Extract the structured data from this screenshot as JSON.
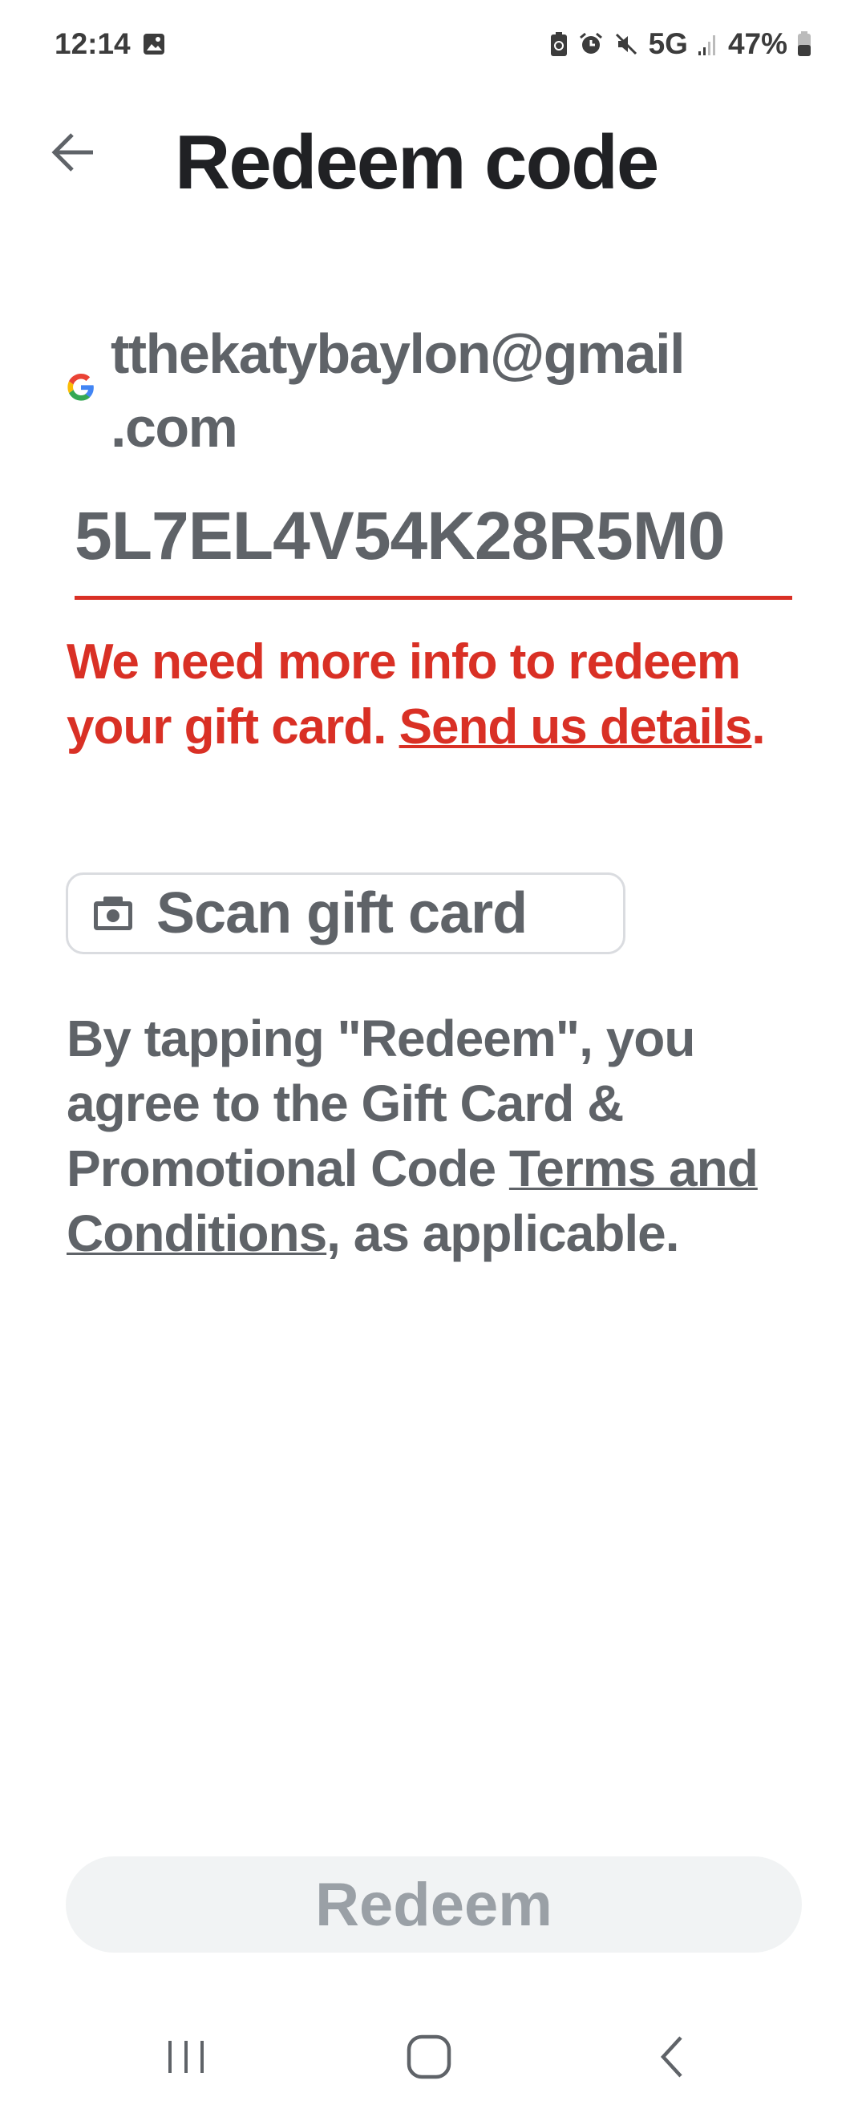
{
  "status_bar": {
    "time": "12:14",
    "network": "5G",
    "battery": "47%",
    "icons": [
      "image-icon",
      "battery-saver-icon",
      "alarm-icon",
      "mute-icon",
      "signal-icon",
      "battery-icon"
    ]
  },
  "header": {
    "title": "Redeem code",
    "back_icon": "arrow-left-icon"
  },
  "account": {
    "email": "tthekatybaylon@gmail.com",
    "email_line1": "tthekatybaylon@gmail",
    "email_line2": ".com"
  },
  "code_input": {
    "value": "5L7EL4V54K28R5M0",
    "underline_color": "#d93025"
  },
  "error": {
    "text": "We need more info to redeem your gift card. ",
    "link": "Send us details",
    "suffix": ".",
    "color": "#d93025"
  },
  "scan_button": {
    "label": "Scan gift card",
    "icon": "camera-icon"
  },
  "terms": {
    "prefix": "By tapping \"Redeem\", you agree to the Gift Card & Promotional Code ",
    "link": "Terms and Conditions",
    "suffix": ", as applicable."
  },
  "redeem_button": {
    "label": "Redeem",
    "enabled": false
  },
  "nav_bar": {
    "icons": [
      "recent-apps-icon",
      "home-icon",
      "back-icon"
    ]
  }
}
